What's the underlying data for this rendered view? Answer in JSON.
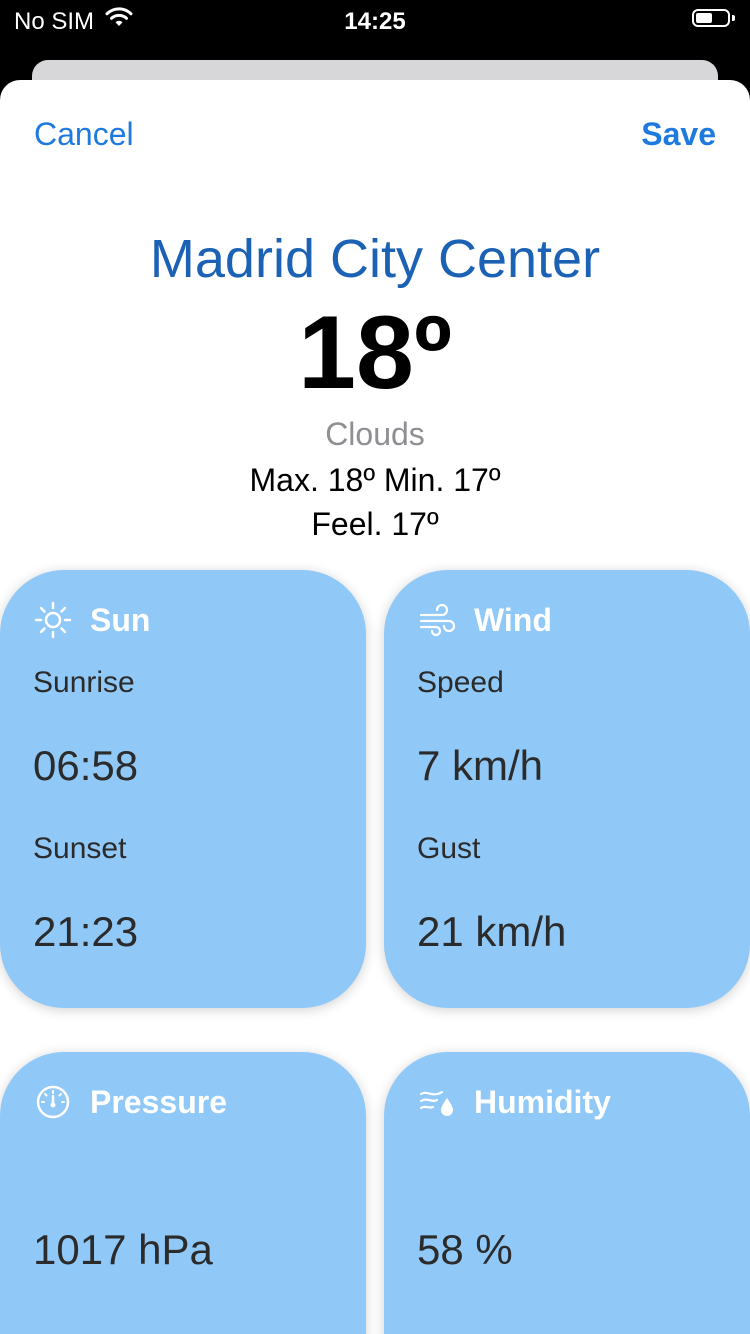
{
  "status_bar": {
    "carrier": "No SIM",
    "time": "14:25",
    "wifi_icon": "wifi-icon",
    "battery_icon": "battery-icon"
  },
  "nav": {
    "cancel_label": "Cancel",
    "save_label": "Save"
  },
  "weather": {
    "city": "Madrid City Center",
    "temperature": "18º",
    "condition": "Clouds",
    "max_min": "Max. 18º  Min. 17º",
    "feel": "Feel. 17º"
  },
  "cards": {
    "sun": {
      "icon": "sun-icon",
      "title": "Sun",
      "sunrise_label": "Sunrise",
      "sunrise_value": "06:58",
      "sunset_label": "Sunset",
      "sunset_value": "21:23"
    },
    "wind": {
      "icon": "wind-icon",
      "title": "Wind",
      "speed_label": "Speed",
      "speed_value": "7 km/h",
      "gust_label": "Gust",
      "gust_value": "21 km/h"
    },
    "pressure": {
      "icon": "gauge-icon",
      "title": "Pressure",
      "value": "1017 hPa"
    },
    "humidity": {
      "icon": "humidity-icon",
      "title": "Humidity",
      "value": "58 %"
    }
  },
  "colors": {
    "accent": "#1f7ae0",
    "city_text": "#1c62b4",
    "card_background": "#90c8f7",
    "secondary_text": "#8e8e93"
  }
}
